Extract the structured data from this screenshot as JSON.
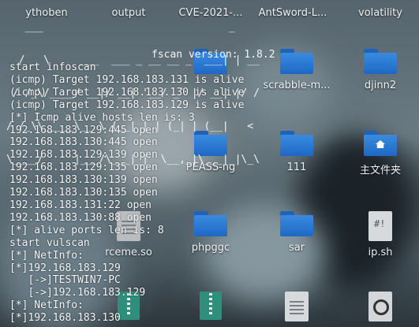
{
  "banner_art": [
    "   ___                              _    ",
    "  / _ \\     ___  ___ _ __ __ _  ___| | __",
    " / /_\\/____/ __|/ __| '__/ _` |/ __| |/ /",
    "/ /_\\\\_____\\__ \\ (__| | | (_| | (__|   < ",
    "\\____/     |___/\\___|_|  \\__,_|\\___|_|\\_\\"
  ],
  "version_text": "fscan version: 1.8.2",
  "terminal_lines": [
    "start infoscan",
    "(icmp) Target 192.168.183.131 is alive",
    "(icmp) Target 192.168.183.130 is alive",
    "(icmp) Target 192.168.183.129 is alive",
    "[*] Icmp alive hosts len is: 3",
    "192.168.183.129:445 open",
    "192.168.183.130:445 open",
    "192.168.183.129:139 open",
    "192.168.183.129:135 open",
    "192.168.183.130:139 open",
    "192.168.183.130:135 open",
    "192.168.183.131:22 open",
    "192.168.183.130:88 open",
    "[*] alive ports len is: 8",
    "start vulscan",
    "[*] NetInfo:",
    "[*]192.168.183.129",
    "   [->]TESTWIN7-PC",
    "   [->]192.168.183.129",
    "[*] NetInfo:",
    "[*]192.168.183.130"
  ],
  "desktop_icons": [
    {
      "label": "volatility",
      "kind": "folder"
    },
    {
      "label": "scrabble-m...",
      "kind": "folder"
    },
    {
      "label": "djinn2",
      "kind": "folder"
    },
    {
      "label": "PEASS-ng",
      "kind": "folder"
    },
    {
      "label": "111",
      "kind": "folder"
    },
    {
      "label": "主文件夹",
      "kind": "home-folder"
    },
    {
      "label": "rceme.so",
      "kind": "document"
    },
    {
      "label": "phpggc",
      "kind": "folder"
    },
    {
      "label": "sar",
      "kind": "folder"
    },
    {
      "label": "ip.sh",
      "kind": "script"
    }
  ],
  "partial_top_labels": [
    "ythoben",
    "output",
    "CVE-2021-...",
    "AntSword-L..."
  ]
}
